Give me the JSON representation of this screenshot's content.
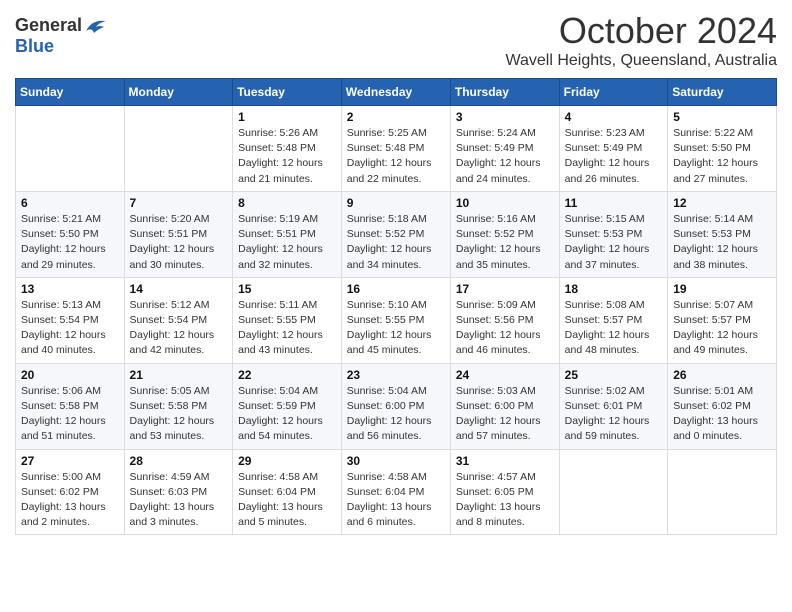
{
  "logo": {
    "general": "General",
    "blue": "Blue"
  },
  "title": "October 2024",
  "location": "Wavell Heights, Queensland, Australia",
  "weekdays": [
    "Sunday",
    "Monday",
    "Tuesday",
    "Wednesday",
    "Thursday",
    "Friday",
    "Saturday"
  ],
  "weeks": [
    [
      {
        "day": "",
        "info": ""
      },
      {
        "day": "",
        "info": ""
      },
      {
        "day": "1",
        "info": "Sunrise: 5:26 AM\nSunset: 5:48 PM\nDaylight: 12 hours and 21 minutes."
      },
      {
        "day": "2",
        "info": "Sunrise: 5:25 AM\nSunset: 5:48 PM\nDaylight: 12 hours and 22 minutes."
      },
      {
        "day": "3",
        "info": "Sunrise: 5:24 AM\nSunset: 5:49 PM\nDaylight: 12 hours and 24 minutes."
      },
      {
        "day": "4",
        "info": "Sunrise: 5:23 AM\nSunset: 5:49 PM\nDaylight: 12 hours and 26 minutes."
      },
      {
        "day": "5",
        "info": "Sunrise: 5:22 AM\nSunset: 5:50 PM\nDaylight: 12 hours and 27 minutes."
      }
    ],
    [
      {
        "day": "6",
        "info": "Sunrise: 5:21 AM\nSunset: 5:50 PM\nDaylight: 12 hours and 29 minutes."
      },
      {
        "day": "7",
        "info": "Sunrise: 5:20 AM\nSunset: 5:51 PM\nDaylight: 12 hours and 30 minutes."
      },
      {
        "day": "8",
        "info": "Sunrise: 5:19 AM\nSunset: 5:51 PM\nDaylight: 12 hours and 32 minutes."
      },
      {
        "day": "9",
        "info": "Sunrise: 5:18 AM\nSunset: 5:52 PM\nDaylight: 12 hours and 34 minutes."
      },
      {
        "day": "10",
        "info": "Sunrise: 5:16 AM\nSunset: 5:52 PM\nDaylight: 12 hours and 35 minutes."
      },
      {
        "day": "11",
        "info": "Sunrise: 5:15 AM\nSunset: 5:53 PM\nDaylight: 12 hours and 37 minutes."
      },
      {
        "day": "12",
        "info": "Sunrise: 5:14 AM\nSunset: 5:53 PM\nDaylight: 12 hours and 38 minutes."
      }
    ],
    [
      {
        "day": "13",
        "info": "Sunrise: 5:13 AM\nSunset: 5:54 PM\nDaylight: 12 hours and 40 minutes."
      },
      {
        "day": "14",
        "info": "Sunrise: 5:12 AM\nSunset: 5:54 PM\nDaylight: 12 hours and 42 minutes."
      },
      {
        "day": "15",
        "info": "Sunrise: 5:11 AM\nSunset: 5:55 PM\nDaylight: 12 hours and 43 minutes."
      },
      {
        "day": "16",
        "info": "Sunrise: 5:10 AM\nSunset: 5:55 PM\nDaylight: 12 hours and 45 minutes."
      },
      {
        "day": "17",
        "info": "Sunrise: 5:09 AM\nSunset: 5:56 PM\nDaylight: 12 hours and 46 minutes."
      },
      {
        "day": "18",
        "info": "Sunrise: 5:08 AM\nSunset: 5:57 PM\nDaylight: 12 hours and 48 minutes."
      },
      {
        "day": "19",
        "info": "Sunrise: 5:07 AM\nSunset: 5:57 PM\nDaylight: 12 hours and 49 minutes."
      }
    ],
    [
      {
        "day": "20",
        "info": "Sunrise: 5:06 AM\nSunset: 5:58 PM\nDaylight: 12 hours and 51 minutes."
      },
      {
        "day": "21",
        "info": "Sunrise: 5:05 AM\nSunset: 5:58 PM\nDaylight: 12 hours and 53 minutes."
      },
      {
        "day": "22",
        "info": "Sunrise: 5:04 AM\nSunset: 5:59 PM\nDaylight: 12 hours and 54 minutes."
      },
      {
        "day": "23",
        "info": "Sunrise: 5:04 AM\nSunset: 6:00 PM\nDaylight: 12 hours and 56 minutes."
      },
      {
        "day": "24",
        "info": "Sunrise: 5:03 AM\nSunset: 6:00 PM\nDaylight: 12 hours and 57 minutes."
      },
      {
        "day": "25",
        "info": "Sunrise: 5:02 AM\nSunset: 6:01 PM\nDaylight: 12 hours and 59 minutes."
      },
      {
        "day": "26",
        "info": "Sunrise: 5:01 AM\nSunset: 6:02 PM\nDaylight: 13 hours and 0 minutes."
      }
    ],
    [
      {
        "day": "27",
        "info": "Sunrise: 5:00 AM\nSunset: 6:02 PM\nDaylight: 13 hours and 2 minutes."
      },
      {
        "day": "28",
        "info": "Sunrise: 4:59 AM\nSunset: 6:03 PM\nDaylight: 13 hours and 3 minutes."
      },
      {
        "day": "29",
        "info": "Sunrise: 4:58 AM\nSunset: 6:04 PM\nDaylight: 13 hours and 5 minutes."
      },
      {
        "day": "30",
        "info": "Sunrise: 4:58 AM\nSunset: 6:04 PM\nDaylight: 13 hours and 6 minutes."
      },
      {
        "day": "31",
        "info": "Sunrise: 4:57 AM\nSunset: 6:05 PM\nDaylight: 13 hours and 8 minutes."
      },
      {
        "day": "",
        "info": ""
      },
      {
        "day": "",
        "info": ""
      }
    ]
  ]
}
